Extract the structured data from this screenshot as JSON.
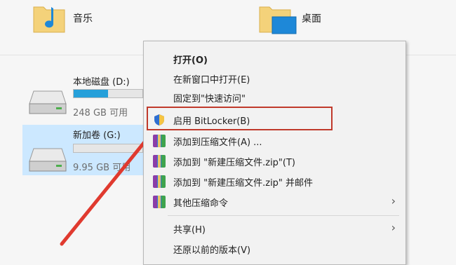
{
  "folders": [
    {
      "label": "音乐",
      "icon": "music-folder-icon"
    },
    {
      "label": "桌面",
      "icon": "desktop-folder-icon"
    }
  ],
  "drives": [
    {
      "label": "本地磁盘 (D:)",
      "free": "248 GB 可用",
      "used_fraction": 0.5,
      "icon": "hard-drive-icon"
    },
    {
      "label": "新加卷 (G:)",
      "free": "9.95 GB 可用",
      "used_fraction": 0.0,
      "icon": "hard-drive-icon"
    }
  ],
  "context_menu": {
    "items": [
      {
        "label": "打开(O)",
        "bold": true
      },
      {
        "label": "在新窗口中打开(E)"
      },
      {
        "label": "固定到\"快速访问\""
      },
      {
        "label": "启用 BitLocker(B)",
        "icon": "shield-icon"
      },
      {
        "label": "添加到压缩文件(A) ...",
        "icon": "winrar-icon"
      },
      {
        "label": "添加到 \"新建压缩文件.zip\"(T)",
        "icon": "winrar-icon"
      },
      {
        "label": "添加到 \"新建压缩文件.zip\" 并邮件",
        "icon": "winrar-icon"
      },
      {
        "label": "其他压缩命令",
        "icon": "winrar-icon",
        "submenu": true
      },
      {
        "label": "共享(H)",
        "submenu": true
      },
      {
        "label": "还原以前的版本(V)"
      }
    ],
    "chevron": "›"
  },
  "colors": {
    "accent": "#26a0da",
    "selection": "#cce8ff",
    "annotation": "#c0392b"
  }
}
